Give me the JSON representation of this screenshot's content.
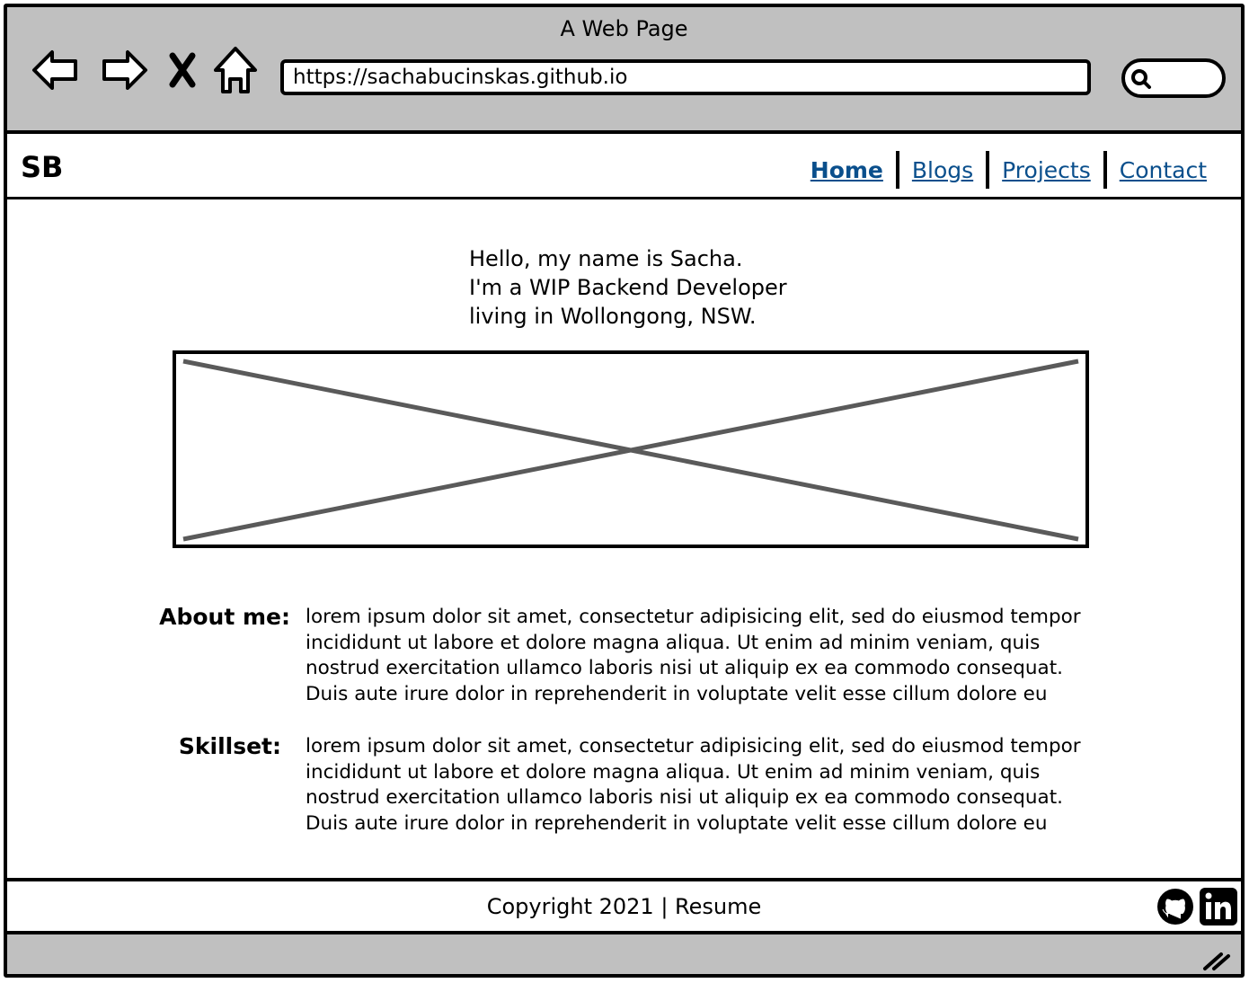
{
  "browser": {
    "window_title": "A Web Page",
    "url": "https://sachabucinskas.github.io",
    "icons": [
      "back-icon",
      "forward-icon",
      "close-icon",
      "home-icon",
      "search-icon"
    ]
  },
  "header": {
    "logo": "SB",
    "nav": [
      {
        "label": "Home",
        "active": true
      },
      {
        "label": "Blogs",
        "active": false
      },
      {
        "label": "Projects",
        "active": false
      },
      {
        "label": "Contact",
        "active": false
      }
    ],
    "link_color": "#0a4f8c"
  },
  "hero": {
    "lines": [
      "Hello, my name is Sacha.",
      "I'm a WIP Backend Developer",
      "living in Wollongong, NSW."
    ]
  },
  "sections": [
    {
      "label": "About me:",
      "text": "lorem ipsum dolor sit amet, consectetur adipisicing elit, sed do eiusmod tempor incididunt ut labore et dolore magna aliqua. Ut enim ad minim veniam, quis nostrud exercitation ullamco laboris nisi ut aliquip ex ea commodo consequat. Duis aute irure dolor in reprehenderit in voluptate velit esse cillum dolore eu"
    },
    {
      "label": "Skillset:",
      "text": "lorem ipsum dolor sit amet, consectetur adipisicing elit, sed do eiusmod tempor incididunt ut labore et dolore magna aliqua. Ut enim ad minim veniam, quis nostrud exercitation ullamco laboris nisi ut aliquip ex ea commodo consequat. Duis aute irure dolor in reprehenderit in voluptate velit esse cillum dolore eu"
    }
  ],
  "footer": {
    "copyright": "Copyright 2021 | Resume",
    "icons": [
      "github-icon",
      "linkedin-icon"
    ]
  },
  "colors": {
    "chrome": "#c0c0c0",
    "placeholder_cross": "#5a5a5a"
  }
}
